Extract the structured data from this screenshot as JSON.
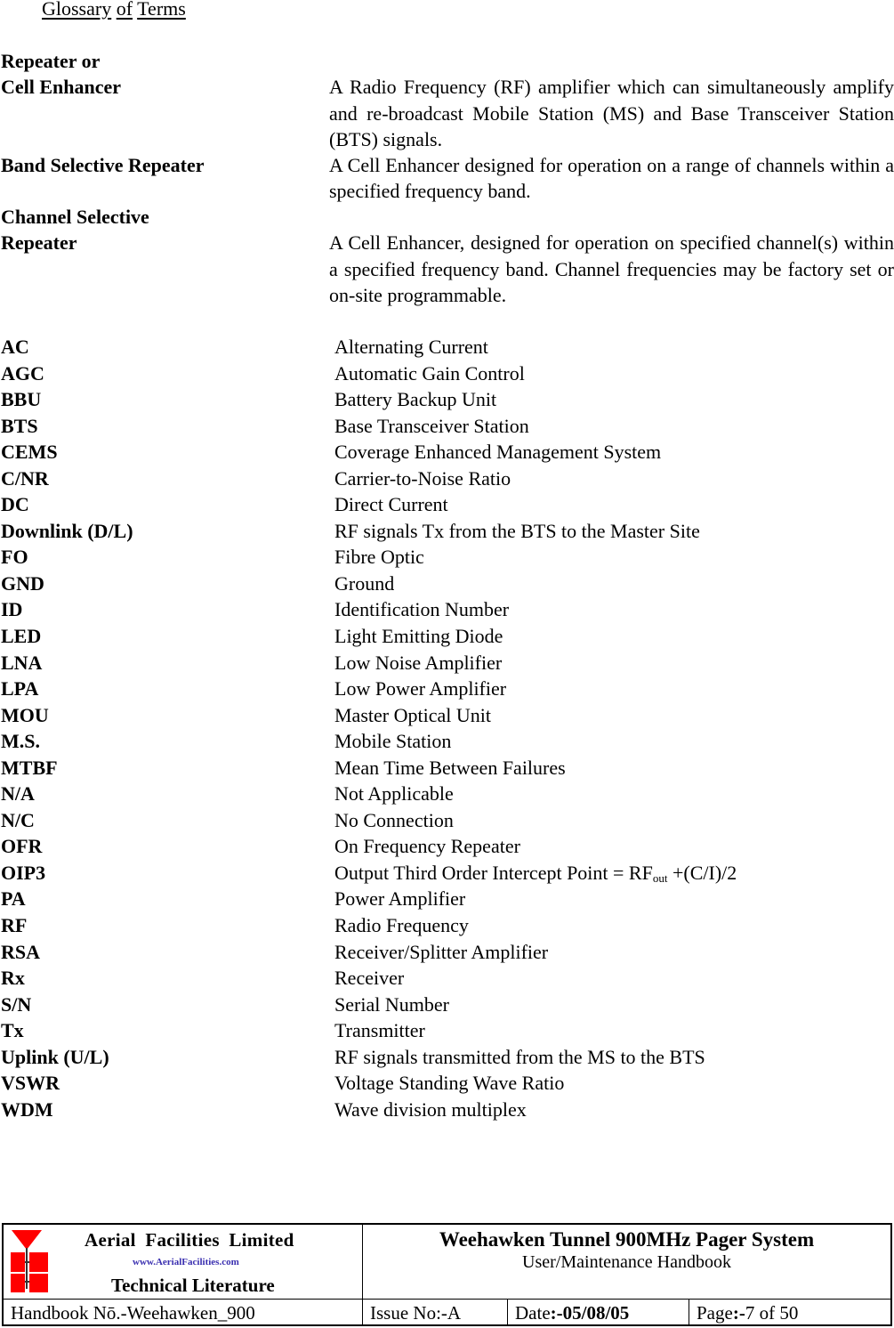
{
  "title": {
    "words": [
      "Glossary",
      "of",
      "Terms"
    ]
  },
  "definitions": [
    {
      "term_lines": [
        "Repeater or",
        "Cell Enhancer"
      ],
      "text": "A Radio Frequency (RF) amplifier which can simultaneously amplify and re-broadcast Mobile Station (MS) and Base Transceiver Station (BTS) signals."
    },
    {
      "term_lines": [
        "Band Selective Repeater"
      ],
      "text": "A Cell Enhancer designed for operation on a range of channels within a specified frequency band."
    },
    {
      "term_lines": [
        "Channel Selective",
        "Repeater"
      ],
      "text": "A Cell Enhancer, designed for operation on specified channel(s) within a specified frequency band. Channel frequencies may be factory set or on-site programmable."
    }
  ],
  "abbreviations": [
    {
      "term": "AC",
      "definition": "Alternating Current"
    },
    {
      "term": "AGC",
      "definition": "Automatic Gain Control"
    },
    {
      "term": "BBU",
      "definition": "Battery Backup Unit"
    },
    {
      "term": "BTS",
      "definition": "Base Transceiver Station"
    },
    {
      "term": "CEMS",
      "definition": "Coverage Enhanced Management System"
    },
    {
      "term": "C/NR",
      "definition": "Carrier-to-Noise Ratio"
    },
    {
      "term": "DC",
      "definition": "Direct Current"
    },
    {
      "term": "Downlink (D/L)",
      "definition": "RF signals Tx from the BTS to the Master Site"
    },
    {
      "term": "FO",
      "definition": "Fibre Optic"
    },
    {
      "term": "GND",
      "definition": "Ground"
    },
    {
      "term": "ID",
      "definition": "Identification Number"
    },
    {
      "term": "LED",
      "definition": "Light Emitting Diode"
    },
    {
      "term": "LNA",
      "definition": "Low Noise Amplifier"
    },
    {
      "term": "LPA",
      "definition": "Low Power Amplifier"
    },
    {
      "term": "MOU",
      "definition": "Master Optical Unit"
    },
    {
      "term": "M.S.",
      "definition": "Mobile Station"
    },
    {
      "term": "MTBF",
      "definition": "Mean Time Between Failures"
    },
    {
      "term": "N/A",
      "definition": "Not Applicable"
    },
    {
      "term": "N/C",
      "definition": "No Connection"
    },
    {
      "term": "OFR",
      "definition": "On Frequency Repeater"
    },
    {
      "term": "OIP3",
      "definition": "Output Third Order Intercept Point = RF",
      "definition_sub": "out",
      "definition_suffix": " +(C/I)/2"
    },
    {
      "term": "PA",
      "definition": "Power Amplifier"
    },
    {
      "term": "RF",
      "definition": "Radio Frequency"
    },
    {
      "term": "RSA",
      "definition": "Receiver/Splitter Amplifier"
    },
    {
      "term": "Rx",
      "definition": "Receiver"
    },
    {
      "term": "S/N",
      "definition": "Serial Number"
    },
    {
      "term": "Tx",
      "definition": "Transmitter"
    },
    {
      "term": "Uplink (U/L)",
      "definition": "RF signals transmitted from the MS to the BTS"
    },
    {
      "term": "VSWR",
      "definition": "Voltage Standing Wave Ratio"
    },
    {
      "term": "WDM",
      "definition": "Wave division multiplex"
    }
  ],
  "footer": {
    "logo": {
      "company": "Aerial  Facilities  Limited",
      "url": "www.AerialFacilities.com",
      "tagline": "Technical Literature",
      "icon": "antenna-logo-icon",
      "brand_color": "#ff0000",
      "url_color": "#3a2fb0"
    },
    "system_title": "Weehawken Tunnel 900MHz Pager System",
    "subtitle": "User/Maintenance Handbook",
    "handbook_no": "Handbook Nō.-Weehawken_900",
    "issue": "Issue No:-A",
    "date_label": "Date",
    "date_value": ":-05/08/05",
    "page_label": "Page",
    "page_value": ":-",
    "page_number": "7 of 50"
  }
}
